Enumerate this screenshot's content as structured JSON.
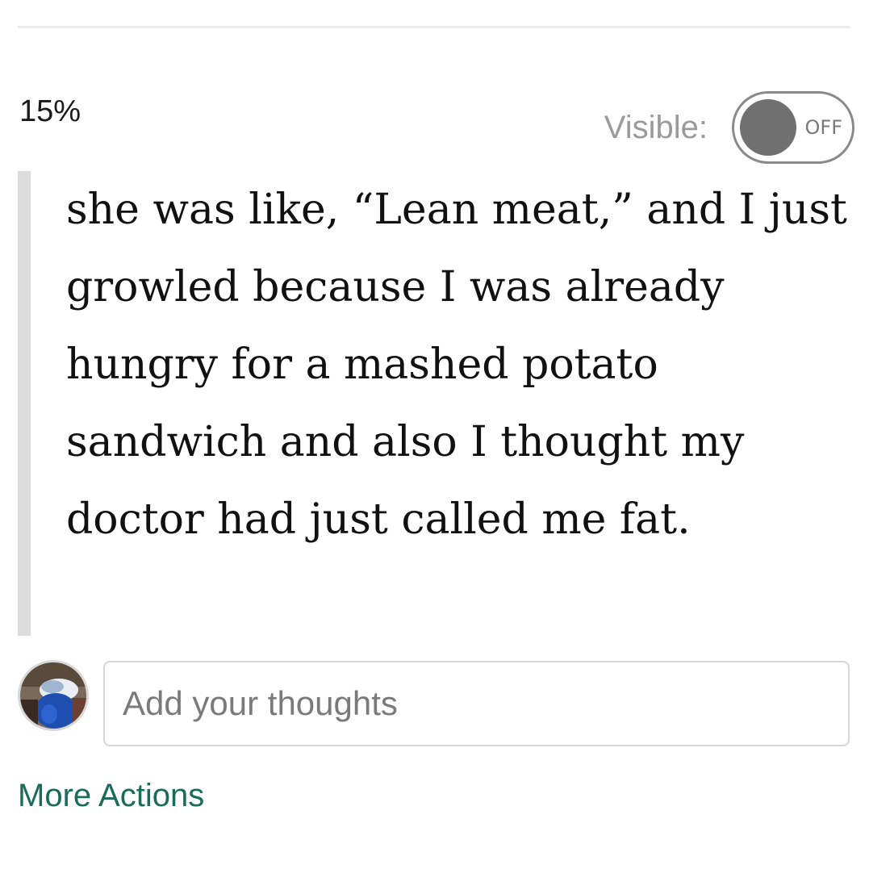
{
  "header": {
    "progress_text": "15%"
  },
  "visibility": {
    "label": "Visible:",
    "toggle_state": "OFF"
  },
  "highlight": {
    "text": "she was like, “Lean meat,” and I just growled because I was already hungry for a mashed potato sandwich and also I thought my doctor had just called me fat."
  },
  "comment": {
    "placeholder": "Add your thoughts",
    "value": ""
  },
  "footer": {
    "more_actions_label": "More Actions"
  },
  "colors": {
    "accent_link": "#1a6b58",
    "quote_bar": "#dcdcdc",
    "toggle_knob": "#707070"
  },
  "icons": {
    "avatar": "user-avatar-photo"
  }
}
